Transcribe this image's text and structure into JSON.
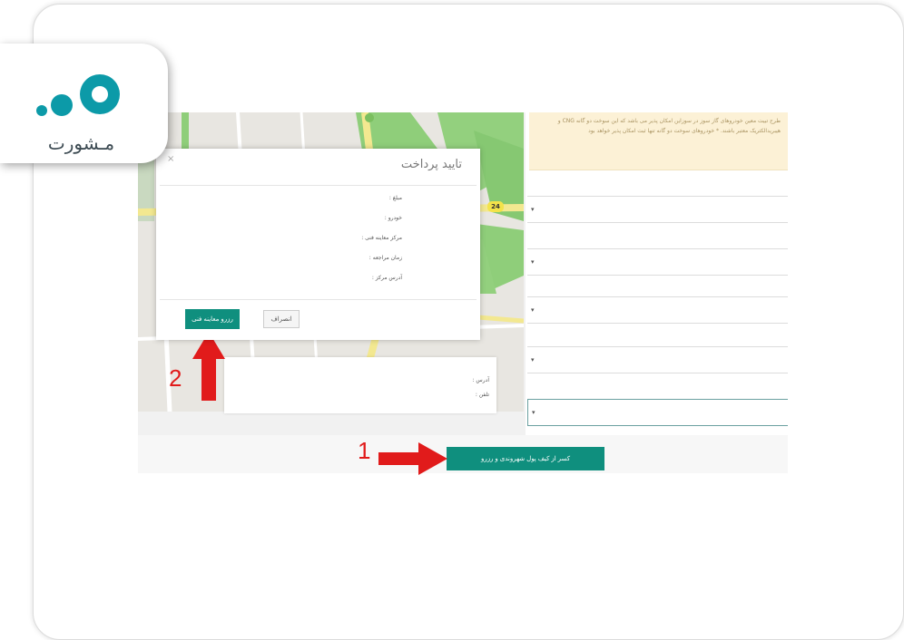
{
  "logo": {
    "brand_text": "مـشورت",
    "colors": {
      "dots": "#0c9aa8",
      "text": "#3c4a52"
    }
  },
  "map": {
    "zoom_in": "+",
    "zoom_out": "−",
    "route_badge": "24"
  },
  "notice": {
    "text": "طرح تبیت معین خودروهای گاز سوز در سوزاین امکان پذیر می باشد که این سوخت دو گانه CNG و هیبریدالکتریک معتبر باشند. * خودروهای سوخت دو گانه تنها ثبت امکان پذیر خواهد بود"
  },
  "selects": [
    {
      "caret": "▾"
    },
    {
      "caret": "▾"
    },
    {
      "caret": "▾"
    },
    {
      "caret": "▾"
    },
    {
      "caret": "▾"
    }
  ],
  "modal": {
    "title": "تایید پرداخت",
    "close": "×",
    "fields": [
      {
        "label": "مبلغ :"
      },
      {
        "label": "خودرو :"
      },
      {
        "label": "مرکز معاینه فنی :"
      },
      {
        "label": "زمان مراجعه :"
      },
      {
        "label": "آدرس مرکز :"
      }
    ],
    "reserve_button": "رزرو معاینه فنی",
    "cancel_button": "انصراف"
  },
  "address_panel": {
    "address_label": "آدرس :",
    "phone_label": "تلفن :"
  },
  "bottom": {
    "wallet_button": "کسر از کیف پول شهروندی و رزرو"
  },
  "annotations": {
    "step1": "1",
    "step2": "2",
    "arrow_color": "#e11b1b"
  },
  "colors": {
    "accent": "#0f8f7e",
    "notice_bg": "#fcf1d6",
    "map_green": "#8fce7a",
    "road_yellow": "#f3e890"
  }
}
